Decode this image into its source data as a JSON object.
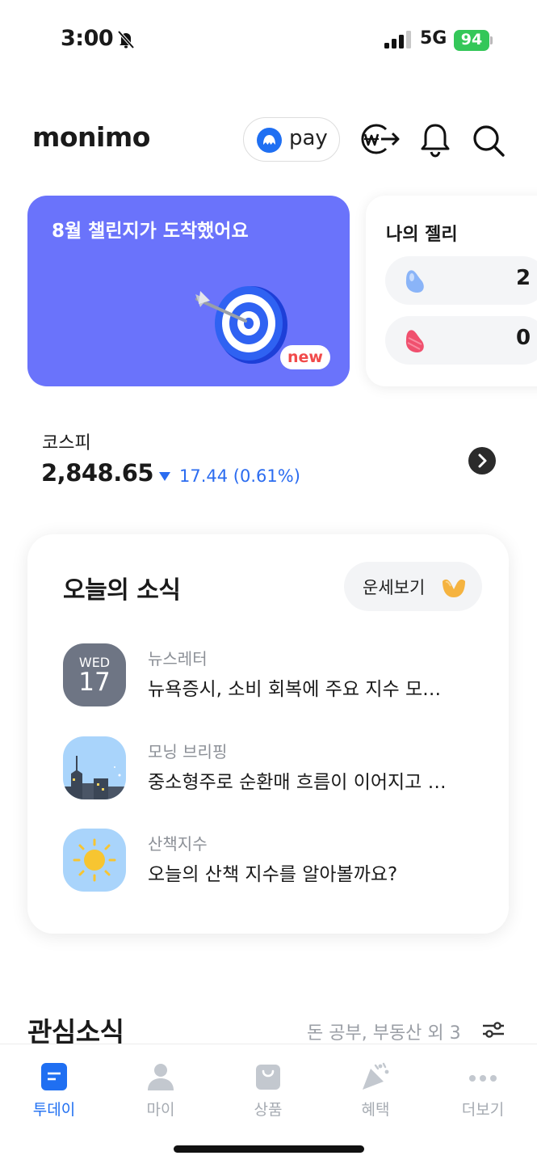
{
  "status_bar": {
    "time": "3:00",
    "network": "5G",
    "battery": "94"
  },
  "header": {
    "logo": "monimo",
    "pay_label": "pay"
  },
  "challenge_card": {
    "title": "8월 챌린지가 도착했어요",
    "badge": "new",
    "accent_color": "#6a73fb"
  },
  "jelly_card": {
    "title": "나의 젤리",
    "items": [
      {
        "color": "#8ab4f8",
        "count": "2"
      },
      {
        "color": "#f0506e",
        "count": "0"
      }
    ]
  },
  "kospi": {
    "label": "코스피",
    "value": "2,848.65",
    "change": "17.44 (0.61%)",
    "direction": "down",
    "change_color": "#2b6cf0"
  },
  "news": {
    "title": "오늘의 소식",
    "fortune_label": "운세보기",
    "items": [
      {
        "category": "뉴스레터",
        "headline": "뉴욕증시, 소비 회복에 주요 지수 모…",
        "thumb_day": "WED",
        "thumb_date": "17"
      },
      {
        "category": "모닝 브리핑",
        "headline": "중소형주로 순환매 흐름이 이어지고 …"
      },
      {
        "category": "산책지수",
        "headline": "오늘의 산책 지수를 알아볼까요?"
      }
    ]
  },
  "interest": {
    "title": "관심소식",
    "topics": "돈 공부, 부동산 외 3"
  },
  "tab_bar": {
    "active_color": "#1f6ff2",
    "tabs": [
      {
        "label": "투데이",
        "icon": "today-icon",
        "active": true
      },
      {
        "label": "마이",
        "icon": "person-icon",
        "active": false
      },
      {
        "label": "상품",
        "icon": "bag-icon",
        "active": false
      },
      {
        "label": "혜택",
        "icon": "party-icon",
        "active": false
      },
      {
        "label": "더보기",
        "icon": "more-icon",
        "active": false
      }
    ]
  }
}
